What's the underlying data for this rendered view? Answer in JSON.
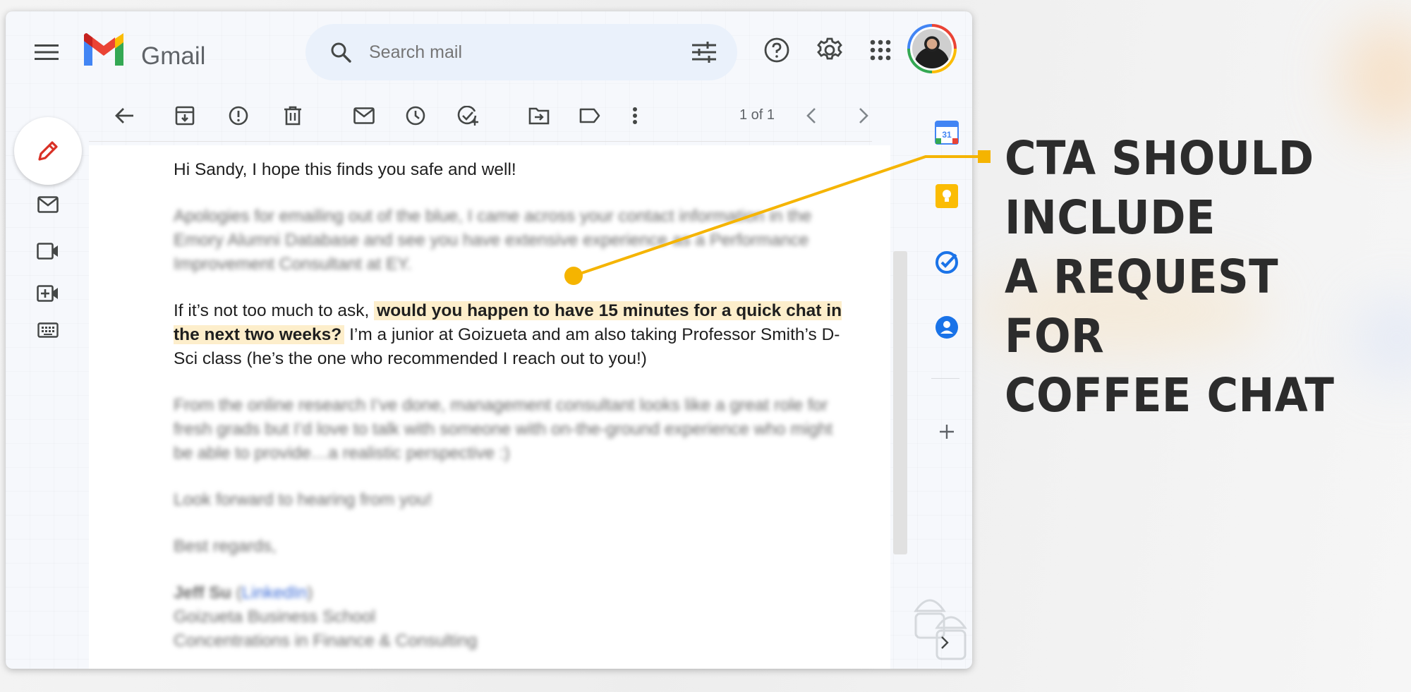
{
  "app": {
    "brand": "Gmail"
  },
  "search": {
    "placeholder": "Search mail"
  },
  "toolbar": {
    "pager": "1 of 1"
  },
  "email": {
    "greeting": "Hi Sandy, I hope this finds you safe and well!",
    "para1": "Apologies for emailing out of the blue, I came across your contact information in the Emory Alumni Database and see you have extensive experience as a Performance Improvement Consultant at EY.",
    "para2_before": "If it’s not too much to ask, ",
    "para2_highlight": "would you happen to have 15 minutes for a quick chat in the next two weeks?",
    "para2_after": " I’m a junior at Goizueta and am also taking Professor Smith’s D-Sci class (he’s the one who recommended I reach out to you!)",
    "para3": "From the online research I’ve done, management consultant looks like a great role for fresh grads but I’d love to talk with someone with on-the-ground experience who might be able to provide…a realistic perspective :)",
    "para4": "Look forward to hearing from you!",
    "closing": "Best regards,",
    "sig_name": "Jeff Su",
    "sig_link": "LinkedIn",
    "sig_line1": "Goizueta Business School",
    "sig_line2": "Concentrations in Finance & Consulting"
  },
  "callout": {
    "line1": "CTA should include",
    "line2": "a request for",
    "line3": "Coffee chat"
  },
  "colors": {
    "accent": "#f5b400",
    "highlight": "#fdeecb",
    "gmail_red": "#ea4335",
    "gmail_blue": "#4285f4",
    "gmail_green": "#34a853",
    "gmail_yellow": "#fbbc04"
  }
}
